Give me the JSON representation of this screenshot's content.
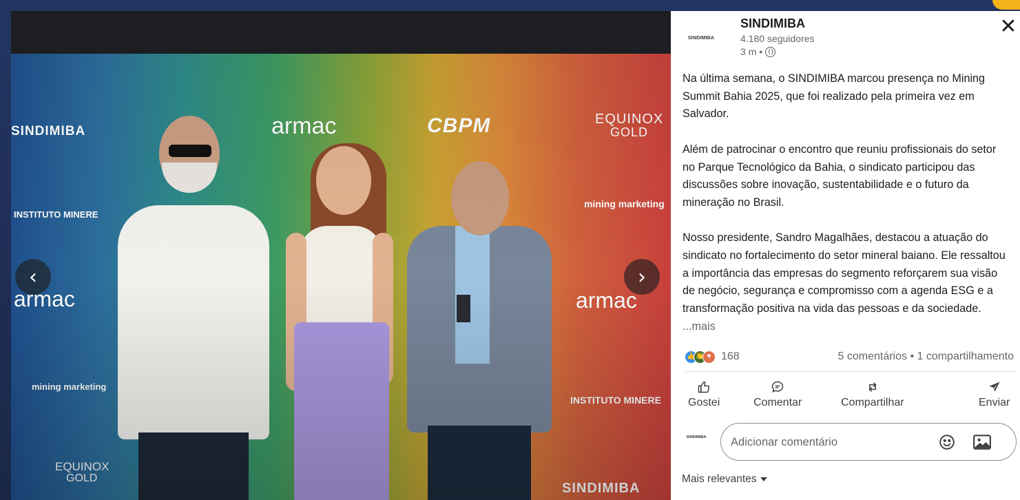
{
  "post": {
    "author": "SINDIMIBA",
    "avatar_text": "SINDIMIBA",
    "followers": "4.180 seguidores",
    "time": "3 m •",
    "paragraphs": [
      "Na última semana, o SINDIMIBA marcou presença no Mining Summit Bahia 2025, que foi realizado pela primeira vez em Salvador.",
      "Além de patrocinar o encontro que reuniu profissionais do setor no Parque Tecnológico da Bahia, o sindicato participou das discussões  sobre inovação, sustentabilidade e o futuro da mineração no Brasil.",
      "Nosso presidente, Sandro Magalhães, destacou a atuação do sindicato no fortalecimento do setor mineral baiano. Ele ressaltou a importância das empresas do segmento reforçarem sua visão de negócio, segurança e compromisso com a agenda ESG e a transformação positiva na vida das pessoas e da sociedade. "
    ],
    "more_label": "...mais",
    "reaction_count": "168",
    "engagement": "5 comentários • 1 compartilhamento"
  },
  "actions": {
    "like": "Gostei",
    "comment": "Comentar",
    "share": "Compartilhar",
    "send": "Enviar"
  },
  "comment": {
    "avatar_text": "SINDIMIBA",
    "placeholder": "Adicionar comentário"
  },
  "sort": {
    "label": "Mais relevantes"
  },
  "media": {
    "prev_label": "‹",
    "next_label": "›",
    "backdrop_logos": {
      "sindimiba_left": "SINDIMIBA",
      "armac_top": "armac",
      "cbpm": "CBPM",
      "equinox_top": "EQUINOX",
      "equinox_top_2": "GOLD",
      "instituto_left": "INSTITUTO MINERE",
      "mining_right": "mining marketing",
      "armac_left": "armac",
      "armac_right": "armac",
      "mining_left": "mining marketing",
      "instituto_right": "INSTITUTO MINERE",
      "equinox_bottom": "EQUINOX",
      "equinox_bottom_2": "GOLD",
      "sindimiba_bottom": "SINDIMIBA"
    }
  },
  "colors": {
    "frame": "#1d2b4f",
    "accent": "#f2b21b",
    "text": "#1d1d1d",
    "muted": "#666666"
  }
}
